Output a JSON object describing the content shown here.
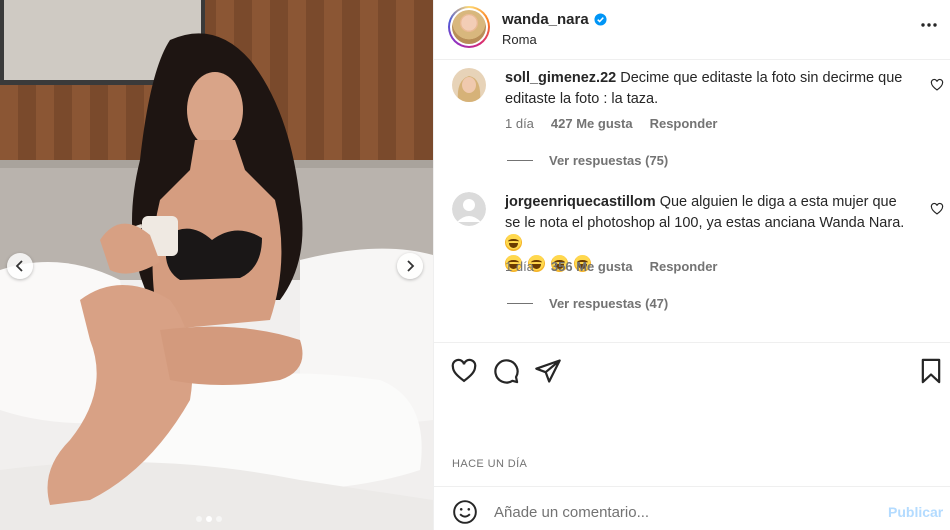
{
  "post": {
    "username": "wanda_nara",
    "location": "Roma",
    "timestamp": "HACE UN DÍA",
    "carousel_count": 3,
    "carousel_active": 1
  },
  "comments": [
    {
      "username": "soll_gimenez.22",
      "text": "Decime que editaste la foto sin decirme que editaste la foto : la taza.",
      "time": "1 día",
      "likes": "427 Me gusta",
      "reply_label": "Responder",
      "view_replies": "Ver respuestas (75)"
    },
    {
      "username": "jorgeenriquecastillom",
      "text": "Que alguien le diga a esta mujer que se le nota el photoshop al 100, ya estas anciana Wanda Nara.",
      "emojis": [
        "grinning-sweat-emoji",
        "grinning-sweat-emoji",
        "grinning-sweat-emoji",
        "grinning-sweat-emoji",
        "grinning-sweat-emoji"
      ],
      "time": "1 día",
      "likes": "356 Me gusta",
      "reply_label": "Responder",
      "view_replies": "Ver respuestas (47)"
    }
  ],
  "add_comment": {
    "placeholder": "Añade un comentario...",
    "publish_label": "Publicar"
  },
  "icons": {
    "more": "more-horizontal-icon",
    "like": "heart-icon",
    "comment": "comment-bubble-icon",
    "share": "paper-plane-icon",
    "save": "bookmark-icon",
    "emoji": "smiley-icon",
    "verified": "verified-badge-icon"
  },
  "colors": {
    "verified": "#0095f6",
    "publish_disabled": "#b3dbff",
    "secondary_text": "#737373"
  }
}
